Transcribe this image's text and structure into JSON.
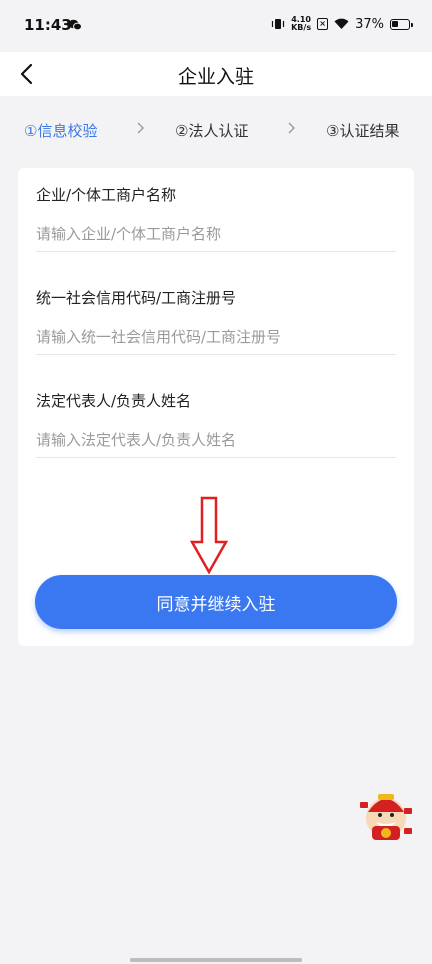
{
  "status": {
    "time": "11:43",
    "speed_top": "4.10",
    "speed_bottom": "KB/s",
    "battery": "37%"
  },
  "nav": {
    "title": "企业入驻"
  },
  "steps": [
    {
      "label": "①信息校验",
      "active": true
    },
    {
      "label": "②法人认证",
      "active": false
    },
    {
      "label": "③认证结果",
      "active": false
    }
  ],
  "form": {
    "fields": [
      {
        "label": "企业/个体工商户名称",
        "placeholder": "请输入企业/个体工商户名称",
        "value": ""
      },
      {
        "label": "统一社会信用代码/工商注册号",
        "placeholder": "请输入统一社会信用代码/工商注册号",
        "value": ""
      },
      {
        "label": "法定代表人/负责人姓名",
        "placeholder": "请输入法定代表人/负责人姓名",
        "value": ""
      }
    ],
    "submit_label": "同意并继续入驻"
  },
  "colors": {
    "accent": "#3a78f2",
    "annotation_arrow": "#e02020"
  },
  "icons": {
    "back": "chevron-left-icon",
    "step_separator": "chevron-right-icon",
    "floating": "mascot-icon"
  }
}
